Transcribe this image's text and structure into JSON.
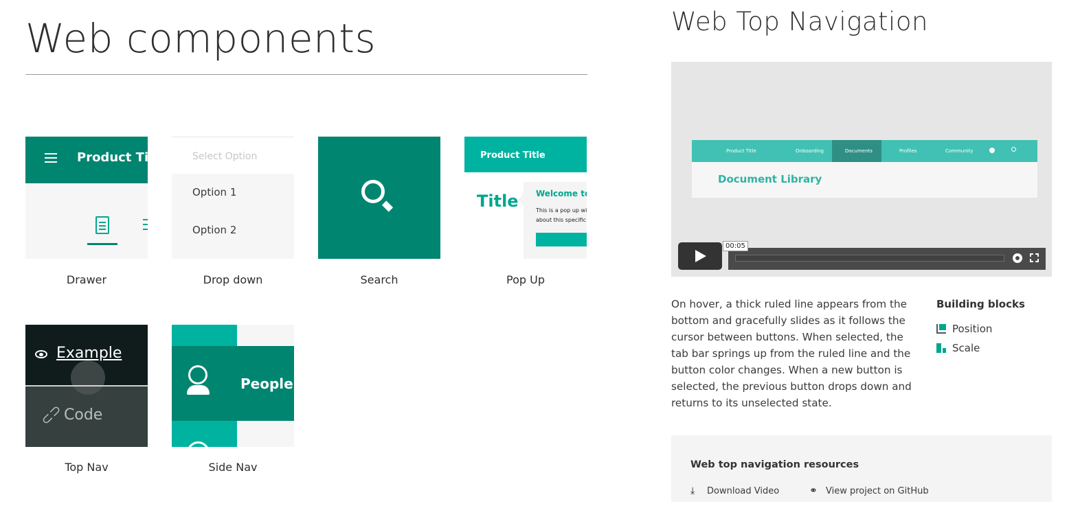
{
  "main": {
    "title": "Web components",
    "tiles": [
      {
        "label": "Drawer"
      },
      {
        "label": "Drop down"
      },
      {
        "label": "Search"
      },
      {
        "label": "Pop Up"
      },
      {
        "label": "Top Nav"
      },
      {
        "label": "Side Nav"
      }
    ],
    "drawer": {
      "product_title": "Product Title"
    },
    "dropdown": {
      "placeholder": "Select Option",
      "options": [
        "Option 1",
        "Option 2"
      ]
    },
    "popup": {
      "bar_title": "Product Title",
      "big_title": "Title",
      "welcome": "Welcome to",
      "body_lines": [
        "This is a pop up wit",
        "about this specific p"
      ]
    },
    "topnav": {
      "example": "Example",
      "code": "Code"
    },
    "sidenav": {
      "people": "People"
    }
  },
  "detail": {
    "title": "Web Top Navigation",
    "video": {
      "nav_items": [
        "Product Title",
        "Onboarding",
        "Documents",
        "Profiles",
        "Community"
      ],
      "page_heading": "Document Library",
      "timestamp": "00:05"
    },
    "description": "On hover, a thick ruled line appears from the bottom and gracefully slides as it follows the cursor between buttons. When selected, the tab bar springs up from the ruled line and the button color changes. When a new button is selected, the previous button drops down and returns to its unselected state.",
    "building_blocks": {
      "title": "Building blocks",
      "items": [
        {
          "label": "Position",
          "icon": "position-icon"
        },
        {
          "label": "Scale",
          "icon": "scale-icon"
        }
      ]
    },
    "resources": {
      "title": "Web top navigation resources",
      "download": "Download Video",
      "github": "View project on GitHub"
    }
  },
  "colors": {
    "teal_dark": "#008571",
    "teal": "#00b3a0",
    "teal_light": "#41c1b3"
  }
}
